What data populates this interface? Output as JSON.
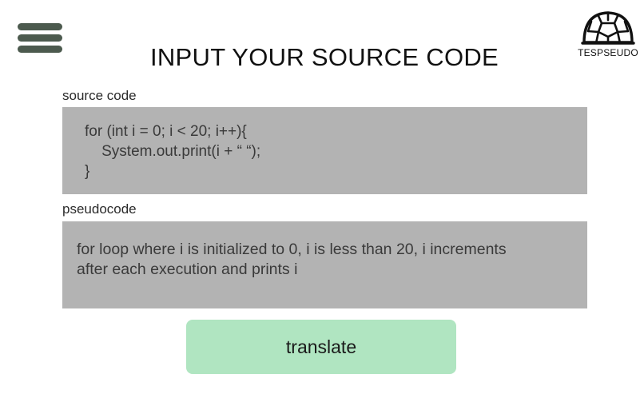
{
  "header": {
    "menu_icon": "hamburger-menu-icon",
    "title": "INPUT YOUR SOURCE CODE",
    "logo": {
      "icon": "turtle-shell-icon",
      "text": "TESPSEUDO"
    }
  },
  "source": {
    "label": "source code",
    "lines": [
      "for (int i = 0; i < 20; i++){",
      "    System.out.print(i + “ “);",
      "}"
    ]
  },
  "pseudocode": {
    "label": "pseudocode",
    "lines": [
      "for loop where i is initialized to 0, i is less than 20, i increments",
      "after each execution and prints i"
    ]
  },
  "actions": {
    "translate_label": "translate"
  },
  "colors": {
    "menu_icon": "#4c5a4e",
    "field_background": "#b3b3b3",
    "button_background": "#b0e5c1"
  }
}
